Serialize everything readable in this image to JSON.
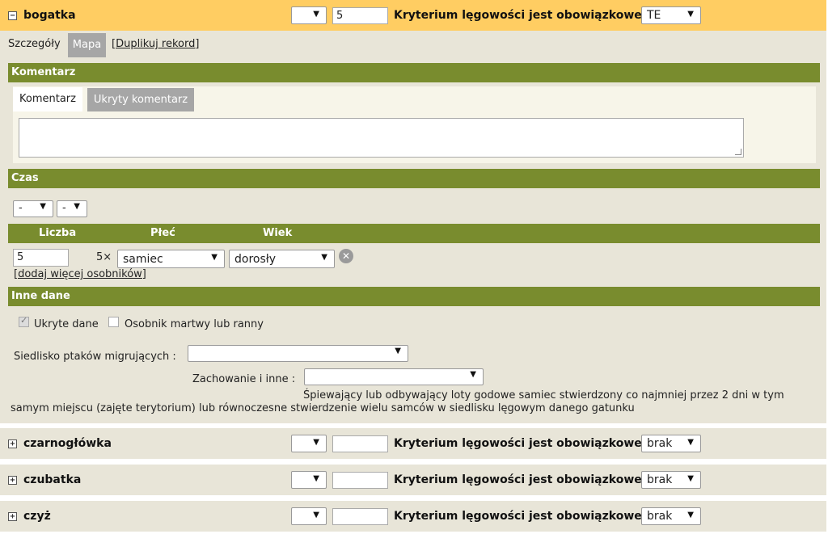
{
  "species": [
    {
      "name": "bogatka",
      "count": "5",
      "criterion_label": "Kryterium lęgowości jest obowiązkowe :",
      "criterion_value": "TE",
      "toggle": "−"
    },
    {
      "name": "czarnogłówka",
      "count": "",
      "criterion_label": "Kryterium lęgowości jest obowiązkowe :",
      "criterion_value": "brak",
      "toggle": "+"
    },
    {
      "name": "czubatka",
      "count": "",
      "criterion_label": "Kryterium lęgowości jest obowiązkowe :",
      "criterion_value": "brak",
      "toggle": "+"
    },
    {
      "name": "czyż",
      "count": "",
      "criterion_label": "Kryterium lęgowości jest obowiązkowe :",
      "criterion_value": "brak",
      "toggle": "+"
    }
  ],
  "tabs": {
    "details": "Szczegóły",
    "map": "Mapa",
    "duplicate": "[Duplikuj rekord]"
  },
  "comment": {
    "section": "Komentarz",
    "tab_active": "Komentarz",
    "tab_hidden": "Ukryty komentarz",
    "value": ""
  },
  "time": {
    "section": "Czas",
    "select1": "-",
    "select2": "-"
  },
  "count_table": {
    "headers": {
      "count": "Liczba",
      "sex": "Płeć",
      "age": "Wiek"
    },
    "count_value": "5",
    "multiplier": "5×",
    "sex_value": "samiec",
    "age_value": "dorosły",
    "add_more": "[dodaj więcej osobników]"
  },
  "other": {
    "section": "Inne dane",
    "hidden_data": "Ukryte dane",
    "dead_injured": "Osobnik martwy lub ranny",
    "migratory_habitat_label": "Siedlisko ptaków migrujących :",
    "behaviour_label": "Zachowanie i inne :",
    "behaviour_desc_line1": "Śpiewający lub odbywający loty godowe samiec stwierdzony co najmniej przez 2 dni w tym",
    "behaviour_desc_line2": "samym miejscu (zajęte terytorium) lub równoczesne stwierdzenie wielu samców w siedlisku lęgowym danego gatunku"
  },
  "arrow_glyph": "▼",
  "colors": {
    "header_active": "#ffcd62",
    "section_bar": "#798c2e",
    "panel_bg": "#e8e5d8"
  }
}
